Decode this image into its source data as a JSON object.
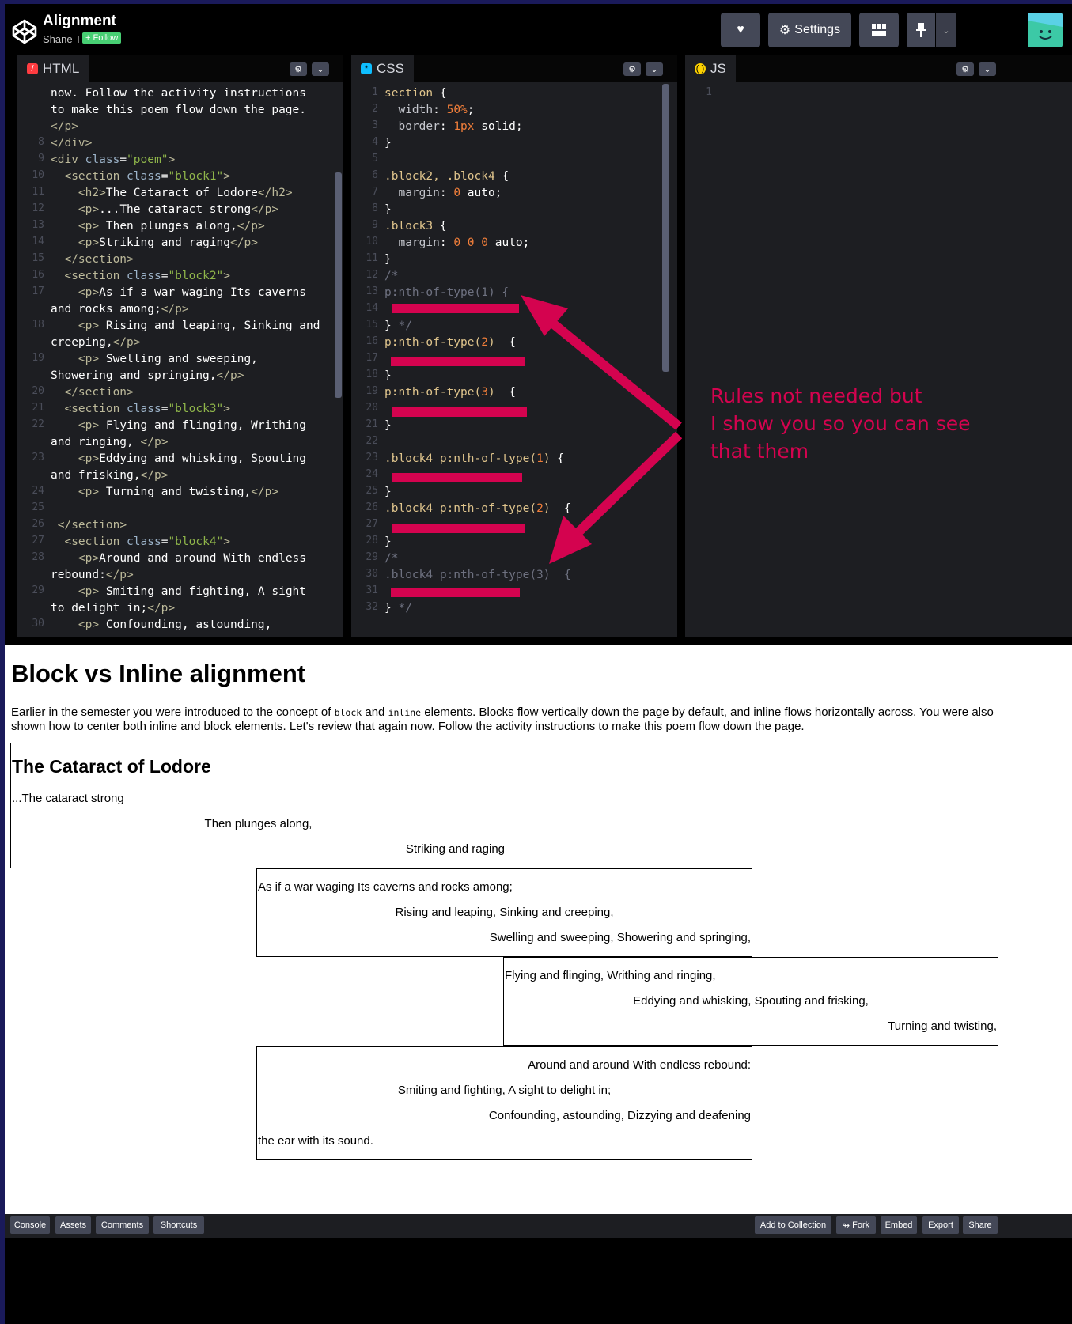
{
  "header": {
    "title": "Alignment",
    "author": "Shane T",
    "follow_label": "+ Follow",
    "settings_label": "Settings"
  },
  "panes": {
    "html": {
      "label": "HTML"
    },
    "css": {
      "label": "CSS"
    },
    "js": {
      "label": "JS"
    }
  },
  "html_code": [
    {
      "n": "",
      "t": "now. Follow the activity instructions"
    },
    {
      "n": "",
      "t": "to make this poem flow down the page."
    },
    {
      "n": "",
      "t": "</p>"
    },
    {
      "n": "8",
      "t": "</div>"
    },
    {
      "n": "9",
      "t": "<div class=\"poem\">"
    },
    {
      "n": "10",
      "t": "  <section class=\"block1\">"
    },
    {
      "n": "11",
      "t": "    <h2>The Cataract of Lodore</h2>"
    },
    {
      "n": "12",
      "t": "    <p>...The cataract strong</p>"
    },
    {
      "n": "13",
      "t": "    <p> Then plunges along,</p>"
    },
    {
      "n": "14",
      "t": "    <p>Striking and raging</p>"
    },
    {
      "n": "15",
      "t": "  </section>"
    },
    {
      "n": "16",
      "t": "  <section class=\"block2\">"
    },
    {
      "n": "17",
      "t": "    <p>As if a war waging Its caverns"
    },
    {
      "n": "",
      "t": "and rocks among;</p>"
    },
    {
      "n": "18",
      "t": "    <p> Rising and leaping, Sinking and"
    },
    {
      "n": "",
      "t": "creeping,</p>"
    },
    {
      "n": "19",
      "t": "    <p> Swelling and sweeping,"
    },
    {
      "n": "",
      "t": "Showering and springing,</p>"
    },
    {
      "n": "20",
      "t": "  </section>"
    },
    {
      "n": "21",
      "t": "  <section class=\"block3\">"
    },
    {
      "n": "22",
      "t": "    <p> Flying and flinging, Writhing"
    },
    {
      "n": "",
      "t": "and ringing, </p>"
    },
    {
      "n": "23",
      "t": "    <p>Eddying and whisking, Spouting"
    },
    {
      "n": "",
      "t": "and frisking,</p>"
    },
    {
      "n": "24",
      "t": "    <p> Turning and twisting,</p>"
    },
    {
      "n": "25",
      "t": ""
    },
    {
      "n": "26",
      "t": " </section>"
    },
    {
      "n": "27",
      "t": "  <section class=\"block4\">"
    },
    {
      "n": "28",
      "t": "    <p>Around and around With endless"
    },
    {
      "n": "",
      "t": "rebound:</p>"
    },
    {
      "n": "29",
      "t": "    <p> Smiting and fighting, A sight"
    },
    {
      "n": "",
      "t": "to delight in;</p>"
    },
    {
      "n": "30",
      "t": "    <p> Confounding, astounding,"
    }
  ],
  "css_code": [
    {
      "n": "1",
      "t": "section {"
    },
    {
      "n": "2",
      "t": "  width: 50%;"
    },
    {
      "n": "3",
      "t": "  border: 1px solid;"
    },
    {
      "n": "4",
      "t": "}"
    },
    {
      "n": "5",
      "t": ""
    },
    {
      "n": "6",
      "t": ".block2, .block4 {"
    },
    {
      "n": "7",
      "t": "  margin: 0 auto;"
    },
    {
      "n": "8",
      "t": "}"
    },
    {
      "n": "9",
      "t": ".block3 {"
    },
    {
      "n": "10",
      "t": "  margin: 0 0 0 auto;"
    },
    {
      "n": "11",
      "t": "}"
    },
    {
      "n": "12",
      "t": "/*"
    },
    {
      "n": "13",
      "t": "p:nth-of-type(1) {"
    },
    {
      "n": "14",
      "t": ""
    },
    {
      "n": "15",
      "t": "} */"
    },
    {
      "n": "16",
      "t": "p:nth-of-type(2)  {"
    },
    {
      "n": "17",
      "t": ""
    },
    {
      "n": "18",
      "t": "}"
    },
    {
      "n": "19",
      "t": "p:nth-of-type(3)  {"
    },
    {
      "n": "20",
      "t": ""
    },
    {
      "n": "21",
      "t": "}"
    },
    {
      "n": "22",
      "t": ""
    },
    {
      "n": "23",
      "t": ".block4 p:nth-of-type(1) {"
    },
    {
      "n": "24",
      "t": ""
    },
    {
      "n": "25",
      "t": "}"
    },
    {
      "n": "26",
      "t": ".block4 p:nth-of-type(2)  {"
    },
    {
      "n": "27",
      "t": ""
    },
    {
      "n": "28",
      "t": "}"
    },
    {
      "n": "29",
      "t": "/*"
    },
    {
      "n": "30",
      "t": ".block4 p:nth-of-type(3)  {"
    },
    {
      "n": "31",
      "t": ""
    },
    {
      "n": "32",
      "t": "} */"
    }
  ],
  "js_code": [
    {
      "n": "1",
      "t": ""
    }
  ],
  "annotation": {
    "line1": "Rules not needed but",
    "line2": "I show you so you can see",
    "line3": "that them"
  },
  "preview": {
    "heading": "Block vs Inline alignment",
    "intro_before": "Earlier in the semester you were introduced to the concept of ",
    "code_block": "block",
    "intro_and": " and ",
    "code_inline": "inline",
    "intro_after": " elements. Blocks flow vertically down the page by default, and inline flows horizontally across. You were also shown how to center both inline and block elements. Let's review that again now. Follow the activity instructions to make this poem flow down the page.",
    "block1": {
      "title": "The Cataract of Lodore",
      "lines": [
        "...The cataract strong",
        "Then plunges along,",
        "Striking and raging"
      ]
    },
    "block2": {
      "lines": [
        "As if a war waging Its caverns and rocks among;",
        "Rising and leaping, Sinking and creeping,",
        "Swelling and sweeping, Showering and springing,"
      ]
    },
    "block3": {
      "lines": [
        "Flying and flinging, Writhing and ringing,",
        "Eddying and whisking, Spouting and frisking,",
        "Turning and twisting,"
      ]
    },
    "block4": {
      "lines": [
        "Around and around With endless rebound:",
        "Smiting and fighting, A sight to delight in;",
        "Confounding, astounding, Dizzying and deafening",
        "the ear with its sound."
      ]
    }
  },
  "bottom_bar": {
    "console": "Console",
    "assets": "Assets",
    "comments": "Comments",
    "shortcuts": "Shortcuts",
    "add_to_collection": "Add to Collection",
    "fork": "Fork",
    "embed": "Embed",
    "export": "Export",
    "share": "Share"
  },
  "colors": {
    "annotation": "#d4034f",
    "follow": "#47cf73",
    "avatar": "#3cc9a6"
  }
}
